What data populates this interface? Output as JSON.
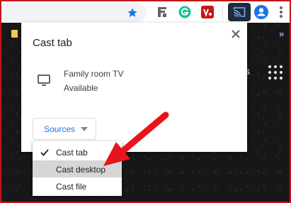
{
  "browser": {
    "toolbar": {
      "star_icon": "star-icon",
      "extensions": [
        "fs-extension-icon",
        "grammarly-icon",
        "vpn-icon"
      ],
      "cast_icon": "cast-icon",
      "profile_icon": "profile-icon",
      "menu_icon": "kebab-menu-icon",
      "accent": "#1a73e8"
    },
    "page": {
      "partial_text": "s",
      "overflow_chevron": "»"
    }
  },
  "cast_dialog": {
    "title": "Cast tab",
    "close_label": "×",
    "sink": {
      "name": "Family room TV",
      "status": "Available",
      "icon": "tv-icon"
    },
    "sources_button": {
      "label": "Sources"
    }
  },
  "sources_menu": {
    "items": [
      {
        "label": "Cast tab",
        "checked": true
      },
      {
        "label": "Cast desktop",
        "highlighted": true
      },
      {
        "label": "Cast file"
      }
    ]
  },
  "annotation": {
    "arrow_color": "#e8141b"
  }
}
